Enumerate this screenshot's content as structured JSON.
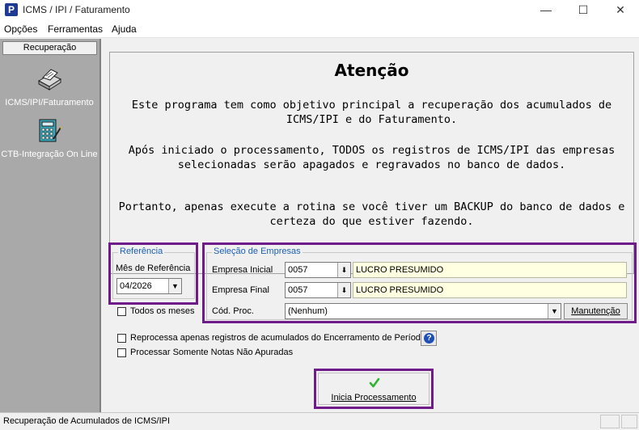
{
  "window": {
    "title": "ICMS / IPI / Faturamento",
    "app_icon_letter": "P"
  },
  "menu": [
    "Opções",
    "Ferramentas",
    "Ajuda"
  ],
  "sidebar": {
    "header": "Recuperação",
    "items": [
      {
        "label": "ICMS/IPI/Faturamento",
        "icon": "printer-icon"
      },
      {
        "label": "CTB-Integração On Line",
        "icon": "calculator-icon"
      }
    ]
  },
  "warning": {
    "title": "Atenção",
    "para1": "Este programa tem como objetivo principal a recuperação dos acumulados de ICMS/IPI e do Faturamento.",
    "para2": "Após iniciado o processamento, TODOS os registros de ICMS/IPI das empresas selecionadas serão apagados e regravados no banco de dados.",
    "para3": "Portanto, apenas execute a rotina se você tiver um BACKUP do banco de dados e certeza do que estiver fazendo."
  },
  "referencia": {
    "legend": "Referência",
    "mes_label": "Mês de Referência",
    "mes_value": "04/2026",
    "todos_meses_label": "Todos os meses",
    "todos_meses_checked": false
  },
  "selecao": {
    "legend": "Seleção de Empresas",
    "empresa_inicial_label": "Empresa Inicial",
    "empresa_inicial_code": "0057",
    "empresa_inicial_name": "LUCRO PRESUMIDO",
    "empresa_final_label": "Empresa Final",
    "empresa_final_code": "0057",
    "empresa_final_name": "LUCRO PRESUMIDO",
    "cod_proc_label": "Cód. Proc.",
    "cod_proc_value": "(Nenhum)",
    "manutencao_label": "Manutenção"
  },
  "options": {
    "reprocessa_label": "Reprocessa apenas registros de acumulados do Encerramento de Período",
    "processar_label": "Processar Somente Notas Não Apuradas"
  },
  "action": {
    "inicia_label": "Inicia Processamento"
  },
  "status": {
    "text": "Recuperação de Acumulados de ICMS/IPI"
  },
  "colors": {
    "highlight": "#6f1c8a",
    "legend_blue": "#1b5fb8",
    "sidebar_bg": "#a9a9a9",
    "field_yellow": "#ffffe1",
    "check_green": "#2fb52f"
  }
}
